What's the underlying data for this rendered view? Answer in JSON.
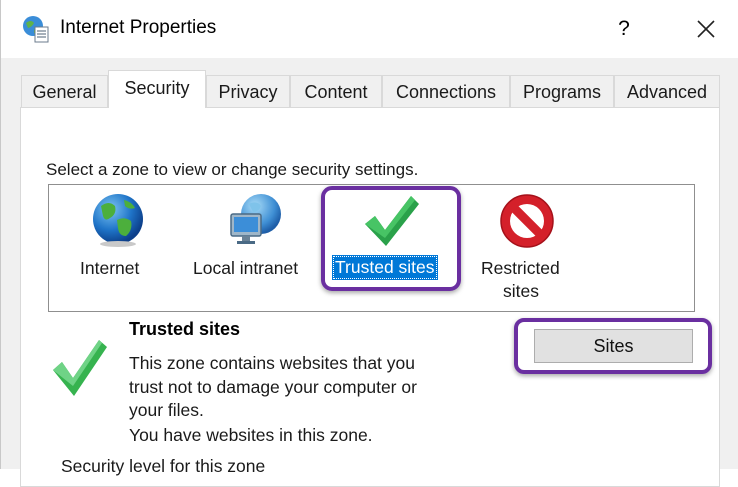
{
  "window": {
    "title": "Internet Properties",
    "help_glyph": "?",
    "icon": "internet-options-icon",
    "close_icon": "close-icon"
  },
  "tabs": [
    {
      "label": "General",
      "active": false
    },
    {
      "label": "Security",
      "active": true
    },
    {
      "label": "Privacy",
      "active": false
    },
    {
      "label": "Content",
      "active": false
    },
    {
      "label": "Connections",
      "active": false
    },
    {
      "label": "Programs",
      "active": false
    },
    {
      "label": "Advanced",
      "active": false
    }
  ],
  "security": {
    "select_zone_label": "Select a zone to view or change security settings.",
    "zones": [
      {
        "label": "Internet",
        "icon": "globe-icon"
      },
      {
        "label": "Local intranet",
        "icon": "local-intranet-icon"
      },
      {
        "label": "Trusted sites",
        "icon": "checkmark-icon",
        "selected": true
      },
      {
        "label_line1": "Restricted",
        "label_line2": "sites",
        "icon": "restricted-icon"
      }
    ],
    "selected_zone": {
      "title": "Trusted sites",
      "description_lines": [
        "This zone contains websites that you",
        "trust not to damage your computer or",
        "your files.",
        "You have websites in this zone."
      ]
    },
    "sites_button_label": "Sites",
    "security_level_label": "Security level for this zone"
  },
  "colors": {
    "highlight_border": "#6a2fa0",
    "selection_blue": "#0078d7",
    "check_green": "#2db24a",
    "restricted_red": "#d4202a"
  }
}
